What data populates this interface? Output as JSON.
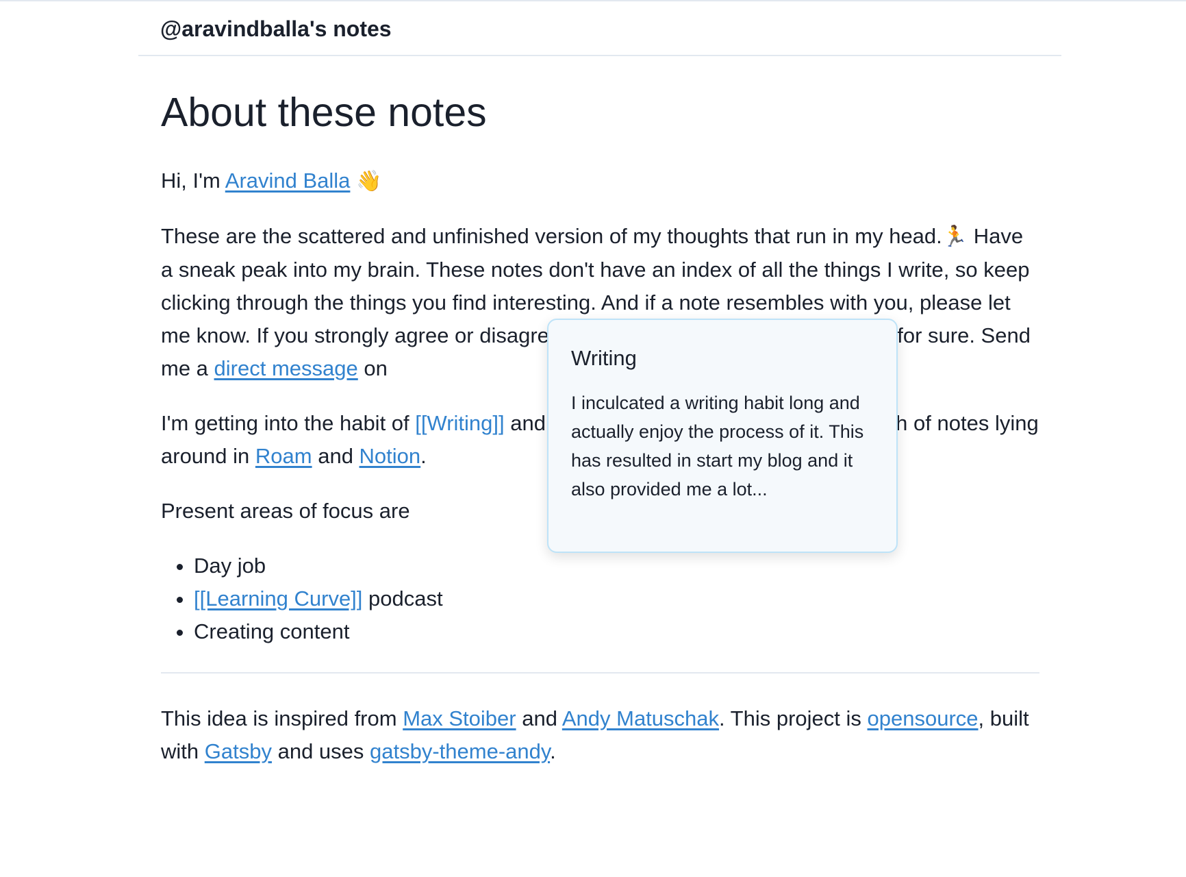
{
  "header": {
    "site_title": "@aravindballa's notes"
  },
  "page": {
    "title": "About these notes",
    "intro": {
      "prefix": "Hi, I'm ",
      "name_link": "Aravind Balla",
      "wave_emoji": "👋"
    },
    "paragraph1": {
      "text_a": "These are the scattered and unfinished version of my thoughts that run in my head.",
      "runner_emoji": "🏃",
      "text_b": " Have a sneak peak into my brain. These notes don't have an index of all the things I write, so keep clicking through the things you find interesting. And if a note resembles with you, please let me know. If you strongly agree or disagree with something, you should tell me for sure. Send me a ",
      "dm_link": "direct message",
      "text_c": " on"
    },
    "paragraph2": {
      "text_a": "I'm getting into the habit of ",
      "writing_link": "[[Writing]]",
      "text_b": " and making notes. There are also a bunch of notes lying around in ",
      "roam_link": "Roam",
      "text_c": " and ",
      "notion_link": "Notion",
      "text_d": "."
    },
    "focus_heading": "Present areas of focus are",
    "focus_list": {
      "item1": "Day job",
      "item2_link": "[[Learning Curve]]",
      "item2_suffix": " podcast",
      "item3": "Creating content"
    },
    "footer": {
      "text_a": "This idea is inspired from ",
      "max_link": "Max Stoiber",
      "text_b": " and ",
      "andy_link": "Andy Matuschak",
      "text_c": ". This project is ",
      "opensource_link": "opensource",
      "text_d": ", built with ",
      "gatsby_link": "Gatsby",
      "text_e": " and uses ",
      "theme_link": "gatsby-theme-andy",
      "text_f": "."
    }
  },
  "popup": {
    "title": "Writing",
    "body": "I inculcated a writing habit long and actually enjoy the process of it. This has resulted in start my blog and it also provided me a lot..."
  },
  "colors": {
    "link": "#3182ce",
    "text": "#1a202c",
    "divider": "#e2e8f0",
    "popup_bg": "#f5f9fc",
    "popup_border": "#bee3f8"
  }
}
